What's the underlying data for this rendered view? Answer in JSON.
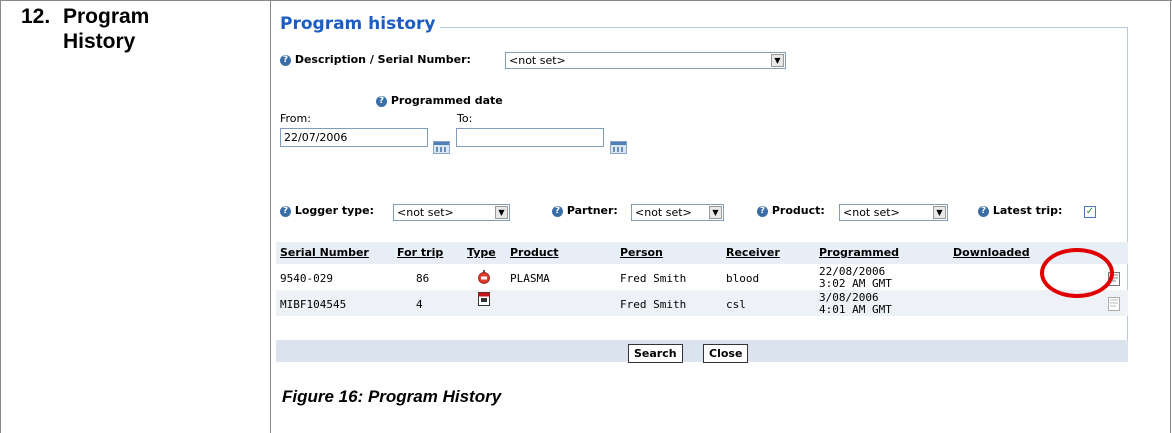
{
  "section": {
    "number": "12.",
    "title_line1": "Program",
    "title_line2": "History"
  },
  "panel": {
    "title": "Program history",
    "description_label": "Description / Serial Number:",
    "description_value": "<not set>",
    "programmed_date_label": "Programmed date",
    "from_label": "From:",
    "from_value": "22/07/2006",
    "to_label": "To:",
    "to_value": "",
    "logger_type_label": "Logger type:",
    "logger_type_value": "<not set>",
    "partner_label": "Partner:",
    "partner_value": "<not set>",
    "product_label": "Product:",
    "product_value": "<not set>",
    "latest_trip_label": "Latest trip:",
    "latest_trip_checked": true
  },
  "table": {
    "headers": [
      "Serial Number",
      "For trip",
      "Type",
      "Product",
      "Person",
      "Receiver",
      "Programmed",
      "Downloaded"
    ],
    "rows": [
      {
        "serial": "9540-029",
        "trip": "86",
        "type_icon": "logger-tag-icon",
        "product": "PLASMA",
        "person": "Fred Smith",
        "receiver": "blood",
        "programmed_date": "22/08/2006",
        "programmed_time": "3:02 AM GMT",
        "downloaded_icon": "document-icon"
      },
      {
        "serial": "MIBF104545",
        "trip": "4",
        "type_icon": "calendar-logger-icon",
        "product": "",
        "person": "Fred Smith",
        "receiver": "csl",
        "programmed_date": "3/08/2006",
        "programmed_time": "4:01 AM GMT",
        "downloaded_icon": "document-icon"
      }
    ]
  },
  "buttons": {
    "search": "Search",
    "close": "Close"
  },
  "caption": "Figure 16: Program History",
  "colors": {
    "title_blue": "#1c5dc4",
    "highlight_red": "#e00000",
    "row_alt": "#eef2f7"
  }
}
